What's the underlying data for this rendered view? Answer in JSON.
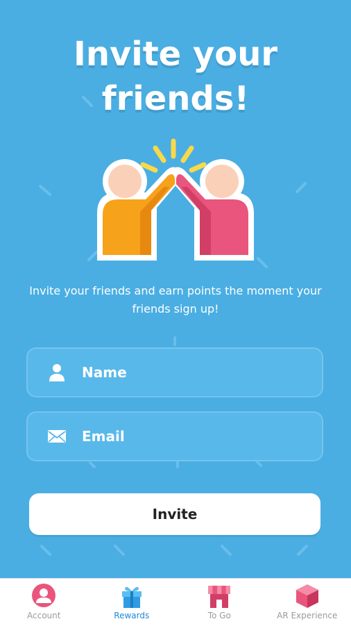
{
  "title_line1": "Invite your",
  "title_line2": "friends!",
  "subtitle": "Invite your friends and earn points the moment your friends sign up!",
  "form": {
    "name_placeholder": "Name",
    "email_placeholder": "Email",
    "invite_label": "Invite"
  },
  "tabs": [
    {
      "label": "Account",
      "icon": "account-icon",
      "active": false
    },
    {
      "label": "Rewards",
      "icon": "gift-icon",
      "active": true
    },
    {
      "label": "To Go",
      "icon": "store-icon",
      "active": false
    },
    {
      "label": "AR Experience",
      "icon": "cube-icon",
      "active": false
    }
  ],
  "colors": {
    "background": "#4aaee3",
    "accent_blue": "#1e88d9",
    "orange": "#f7a21b",
    "pink": "#e9557c",
    "yellow": "#f9d849",
    "skin": "#fbd0b8"
  }
}
